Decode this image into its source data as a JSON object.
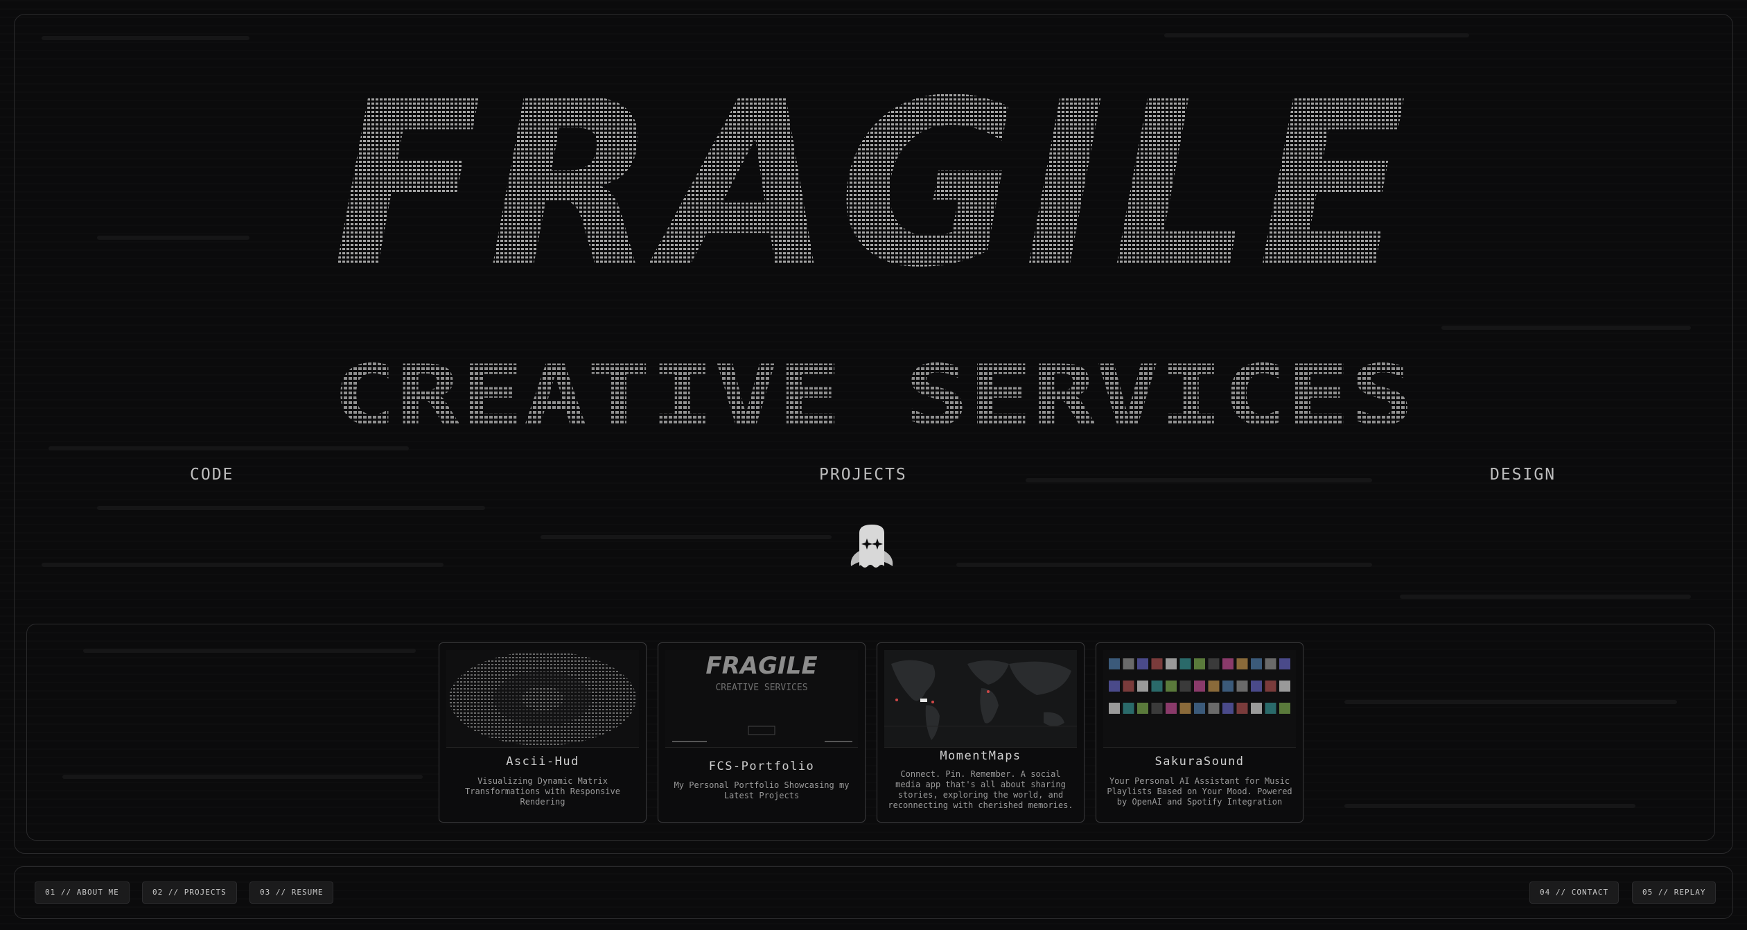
{
  "colors": {
    "background": "#0b0b0c",
    "frame": "#2a2a2c",
    "ascii": "#9d9d9d",
    "text": "#c9c9c9"
  },
  "hero": {
    "title": "FRAGILE",
    "subtitle": "CREATIVE SERVICES"
  },
  "subnav": {
    "left": "CODE",
    "center": "PROJECTS",
    "right": "DESIGN"
  },
  "mascot_icon": "ghost-icon",
  "projects": [
    {
      "title": "Ascii-Hud",
      "description": "Visualizing Dynamic Matrix Transformations with Responsive Rendering"
    },
    {
      "title": "FCS-Portfolio",
      "description": "My Personal Portfolio Showcasing my Latest Projects",
      "thumb_title": "FRAGILE",
      "thumb_subtitle": "CREATIVE SERVICES"
    },
    {
      "title": "MomentMaps",
      "description": "Connect. Pin. Remember. A social media app that's all about sharing stories, exploring the world, and reconnecting with cherished memories."
    },
    {
      "title": "SakuraSound",
      "description": "Your Personal AI Assistant for Music Playlists Based on Your Mood. Powered by OpenAI and Spotify Integration"
    }
  ],
  "footer": {
    "about": "01 // ABOUT ME",
    "projects": "02 // PROJECTS",
    "resume": "03 // RESUME",
    "contact": "04 // CONTACT",
    "replay": "05 // REPLAY"
  }
}
